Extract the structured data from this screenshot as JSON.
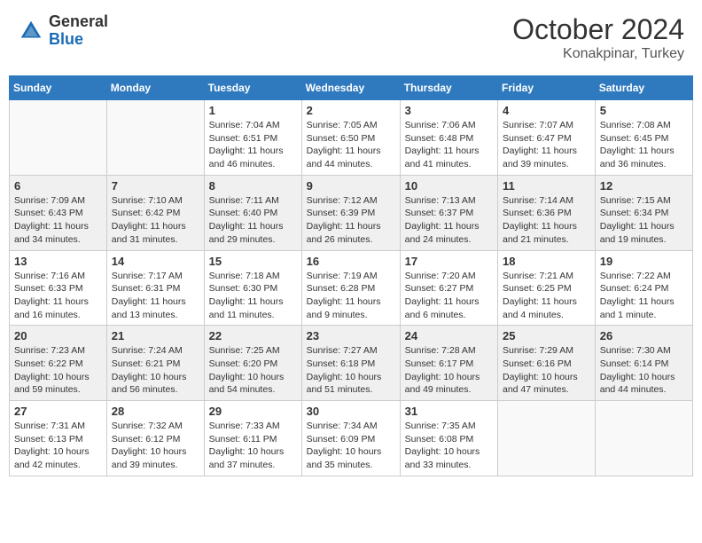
{
  "header": {
    "logo_general": "General",
    "logo_blue": "Blue",
    "month_title": "October 2024",
    "location": "Konakpinar, Turkey"
  },
  "days_of_week": [
    "Sunday",
    "Monday",
    "Tuesday",
    "Wednesday",
    "Thursday",
    "Friday",
    "Saturday"
  ],
  "weeks": [
    [
      {
        "day": "",
        "info": ""
      },
      {
        "day": "",
        "info": ""
      },
      {
        "day": "1",
        "info": "Sunrise: 7:04 AM\nSunset: 6:51 PM\nDaylight: 11 hours and 46 minutes."
      },
      {
        "day": "2",
        "info": "Sunrise: 7:05 AM\nSunset: 6:50 PM\nDaylight: 11 hours and 44 minutes."
      },
      {
        "day": "3",
        "info": "Sunrise: 7:06 AM\nSunset: 6:48 PM\nDaylight: 11 hours and 41 minutes."
      },
      {
        "day": "4",
        "info": "Sunrise: 7:07 AM\nSunset: 6:47 PM\nDaylight: 11 hours and 39 minutes."
      },
      {
        "day": "5",
        "info": "Sunrise: 7:08 AM\nSunset: 6:45 PM\nDaylight: 11 hours and 36 minutes."
      }
    ],
    [
      {
        "day": "6",
        "info": "Sunrise: 7:09 AM\nSunset: 6:43 PM\nDaylight: 11 hours and 34 minutes."
      },
      {
        "day": "7",
        "info": "Sunrise: 7:10 AM\nSunset: 6:42 PM\nDaylight: 11 hours and 31 minutes."
      },
      {
        "day": "8",
        "info": "Sunrise: 7:11 AM\nSunset: 6:40 PM\nDaylight: 11 hours and 29 minutes."
      },
      {
        "day": "9",
        "info": "Sunrise: 7:12 AM\nSunset: 6:39 PM\nDaylight: 11 hours and 26 minutes."
      },
      {
        "day": "10",
        "info": "Sunrise: 7:13 AM\nSunset: 6:37 PM\nDaylight: 11 hours and 24 minutes."
      },
      {
        "day": "11",
        "info": "Sunrise: 7:14 AM\nSunset: 6:36 PM\nDaylight: 11 hours and 21 minutes."
      },
      {
        "day": "12",
        "info": "Sunrise: 7:15 AM\nSunset: 6:34 PM\nDaylight: 11 hours and 19 minutes."
      }
    ],
    [
      {
        "day": "13",
        "info": "Sunrise: 7:16 AM\nSunset: 6:33 PM\nDaylight: 11 hours and 16 minutes."
      },
      {
        "day": "14",
        "info": "Sunrise: 7:17 AM\nSunset: 6:31 PM\nDaylight: 11 hours and 13 minutes."
      },
      {
        "day": "15",
        "info": "Sunrise: 7:18 AM\nSunset: 6:30 PM\nDaylight: 11 hours and 11 minutes."
      },
      {
        "day": "16",
        "info": "Sunrise: 7:19 AM\nSunset: 6:28 PM\nDaylight: 11 hours and 9 minutes."
      },
      {
        "day": "17",
        "info": "Sunrise: 7:20 AM\nSunset: 6:27 PM\nDaylight: 11 hours and 6 minutes."
      },
      {
        "day": "18",
        "info": "Sunrise: 7:21 AM\nSunset: 6:25 PM\nDaylight: 11 hours and 4 minutes."
      },
      {
        "day": "19",
        "info": "Sunrise: 7:22 AM\nSunset: 6:24 PM\nDaylight: 11 hours and 1 minute."
      }
    ],
    [
      {
        "day": "20",
        "info": "Sunrise: 7:23 AM\nSunset: 6:22 PM\nDaylight: 10 hours and 59 minutes."
      },
      {
        "day": "21",
        "info": "Sunrise: 7:24 AM\nSunset: 6:21 PM\nDaylight: 10 hours and 56 minutes."
      },
      {
        "day": "22",
        "info": "Sunrise: 7:25 AM\nSunset: 6:20 PM\nDaylight: 10 hours and 54 minutes."
      },
      {
        "day": "23",
        "info": "Sunrise: 7:27 AM\nSunset: 6:18 PM\nDaylight: 10 hours and 51 minutes."
      },
      {
        "day": "24",
        "info": "Sunrise: 7:28 AM\nSunset: 6:17 PM\nDaylight: 10 hours and 49 minutes."
      },
      {
        "day": "25",
        "info": "Sunrise: 7:29 AM\nSunset: 6:16 PM\nDaylight: 10 hours and 47 minutes."
      },
      {
        "day": "26",
        "info": "Sunrise: 7:30 AM\nSunset: 6:14 PM\nDaylight: 10 hours and 44 minutes."
      }
    ],
    [
      {
        "day": "27",
        "info": "Sunrise: 7:31 AM\nSunset: 6:13 PM\nDaylight: 10 hours and 42 minutes."
      },
      {
        "day": "28",
        "info": "Sunrise: 7:32 AM\nSunset: 6:12 PM\nDaylight: 10 hours and 39 minutes."
      },
      {
        "day": "29",
        "info": "Sunrise: 7:33 AM\nSunset: 6:11 PM\nDaylight: 10 hours and 37 minutes."
      },
      {
        "day": "30",
        "info": "Sunrise: 7:34 AM\nSunset: 6:09 PM\nDaylight: 10 hours and 35 minutes."
      },
      {
        "day": "31",
        "info": "Sunrise: 7:35 AM\nSunset: 6:08 PM\nDaylight: 10 hours and 33 minutes."
      },
      {
        "day": "",
        "info": ""
      },
      {
        "day": "",
        "info": ""
      }
    ]
  ]
}
